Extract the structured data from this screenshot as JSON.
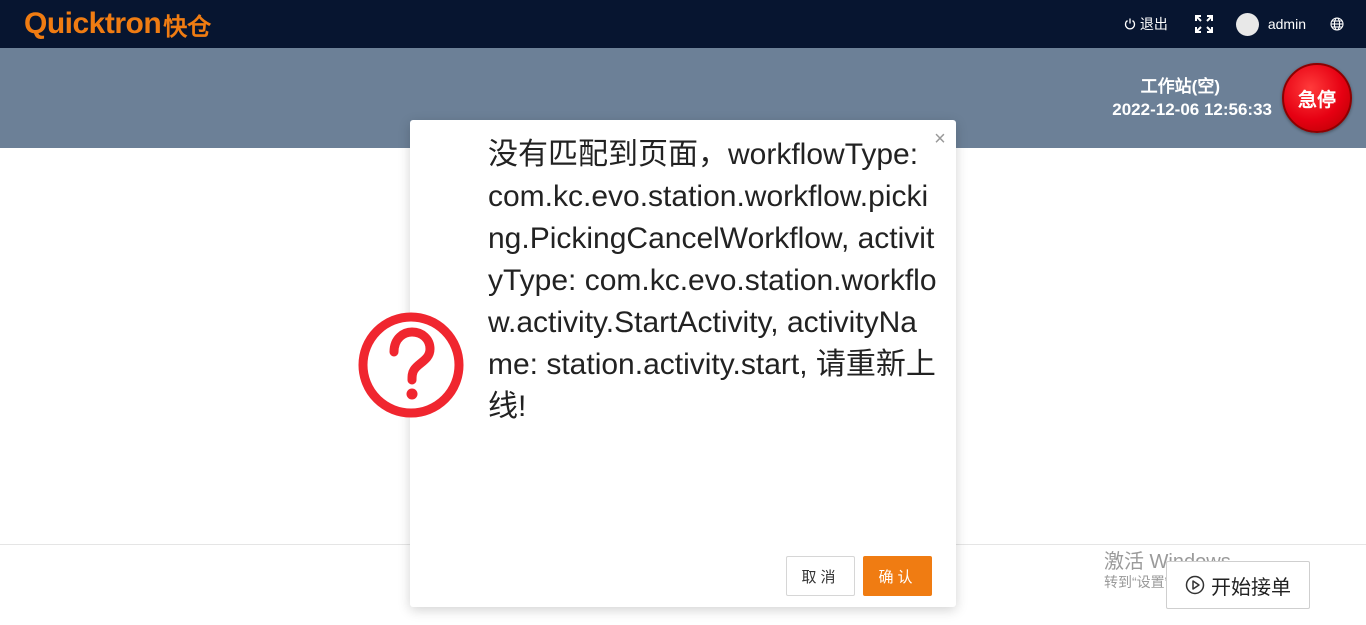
{
  "brand": {
    "name": "Quicktron",
    "name_cn": "快仓",
    "color": "#f07c12"
  },
  "topbar": {
    "logout_label": "退出",
    "user_name": "admin"
  },
  "workstation": {
    "title": "工作站(空)",
    "datetime": "2022-12-06 12:56:33",
    "estop_label": "急停",
    "estop_color": "#e60012"
  },
  "dialog": {
    "message": "没有匹配到页面，workflowType: com.kc.evo.station.workflow.picking.PickingCancelWorkflow, activityType: com.kc.evo.station.workflow.activity.StartActivity, activityName: station.activity.start, 请重新上线!",
    "cancel_label": "取消",
    "ok_label": "确认",
    "icon": "question-circle-icon",
    "icon_color": "#f0262f"
  },
  "footer": {
    "start_label": "开始接单"
  },
  "windows_watermark": {
    "title": "激活 Windows",
    "subtitle": "转到“设置”以激活 Windows。"
  }
}
